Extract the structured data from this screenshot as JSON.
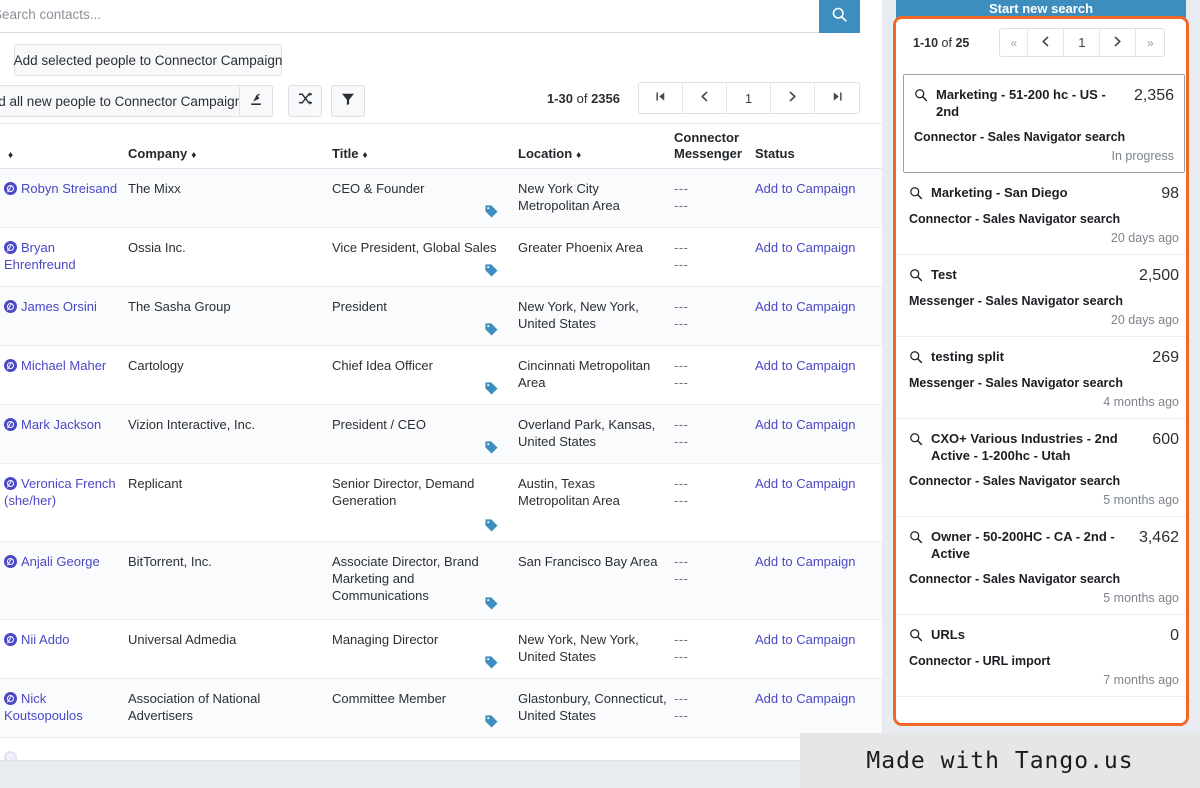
{
  "search": {
    "placeholder": "Search contacts...",
    "value": "",
    "button_icon": "search-icon"
  },
  "toolbar": {
    "add_selected_label": "Add selected people to Connector Campaign",
    "add_all_label": "Add all new people to Connector Campaign",
    "export_icon": "export-icon",
    "shuffle_icon": "shuffle-icon",
    "filter_icon": "filter-icon",
    "help_icon": "help-icon",
    "help_label": "?"
  },
  "main_pagination": {
    "range": "1-30",
    "of": "of",
    "total": "2356",
    "first": "⏮",
    "prev": "‹",
    "page": "1",
    "next": "›",
    "last": "⏭"
  },
  "table": {
    "columns": {
      "name": "",
      "company": "Company",
      "title": "Title",
      "location": "Location",
      "connector": "Connector",
      "messenger": "Messenger",
      "status": "Status"
    },
    "rows": [
      {
        "name": "Robyn Streisand",
        "company": "The Mixx",
        "title": "CEO & Founder",
        "location": "New York City Metropolitan Area",
        "connector": "---",
        "messenger": "---",
        "status": "Add to Campaign"
      },
      {
        "name": "Bryan Ehrenfreund",
        "company": "Ossia Inc.",
        "title": "Vice President, Global Sales",
        "location": "Greater Phoenix Area",
        "connector": "---",
        "messenger": "---",
        "status": "Add to Campaign"
      },
      {
        "name": "James Orsini",
        "company": "The Sasha Group",
        "title": "President",
        "location": "New York, New York, United States",
        "connector": "---",
        "messenger": "---",
        "status": "Add to Campaign"
      },
      {
        "name": "Michael Maher",
        "company": "Cartology",
        "title": "Chief Idea Officer",
        "location": "Cincinnati Metropolitan Area",
        "connector": "---",
        "messenger": "---",
        "status": "Add to Campaign"
      },
      {
        "name": "Mark Jackson",
        "company": "Vizion Interactive, Inc.",
        "title": "President / CEO",
        "location": "Overland Park, Kansas, United States",
        "connector": "---",
        "messenger": "---",
        "status": "Add to Campaign"
      },
      {
        "name": "Veronica French (she/her)",
        "company": "Replicant",
        "title": "Senior Director, Demand Generation",
        "location": "Austin, Texas Metropolitan Area",
        "connector": "---",
        "messenger": "---",
        "status": "Add to Campaign"
      },
      {
        "name": "Anjali George",
        "company": "BitTorrent, Inc.",
        "title": "Associate Director, Brand Marketing and Communications",
        "location": "San Francisco Bay Area",
        "connector": "---",
        "messenger": "---",
        "status": "Add to Campaign"
      },
      {
        "name": "Nii Addo",
        "company": "Universal Admedia",
        "title": "Managing Director",
        "location": "New York, New York, United States",
        "connector": "---",
        "messenger": "---",
        "status": "Add to Campaign"
      },
      {
        "name": "Nick Koutsopoulos",
        "company": "Association of National Advertisers",
        "title": "Committee Member",
        "location": "Glastonbury, Connecticut, United States",
        "connector": "---",
        "messenger": "---",
        "status": "Add to Campaign"
      }
    ]
  },
  "right_panel": {
    "new_search_label": "Start new search",
    "pagination": {
      "range": "1-10",
      "of": "of",
      "total": "25",
      "first": "«",
      "prev": "‹",
      "page": "1",
      "next": "›",
      "last": "»"
    },
    "searches": [
      {
        "title": "Marketing - 51-200 hc - US - 2nd",
        "count": "2,356",
        "source": "Connector - Sales Navigator search",
        "meta": "In progress",
        "selected": true
      },
      {
        "title": "Marketing - San Diego",
        "count": "98",
        "source": "Connector - Sales Navigator search",
        "meta": "20 days ago",
        "selected": false
      },
      {
        "title": "Test",
        "count": "2,500",
        "source": "Messenger - Sales Navigator search",
        "meta": "20 days ago",
        "selected": false
      },
      {
        "title": "testing split",
        "count": "269",
        "source": "Messenger - Sales Navigator search",
        "meta": "4 months ago",
        "selected": false
      },
      {
        "title": "CXO+ Various Industries - 2nd Active - 1-200hc - Utah",
        "count": "600",
        "source": "Connector - Sales Navigator search",
        "meta": "5 months ago",
        "selected": false
      },
      {
        "title": "Owner - 50-200HC - CA - 2nd - Active",
        "count": "3,462",
        "source": "Connector - Sales Navigator search",
        "meta": "5 months ago",
        "selected": false
      },
      {
        "title": "URLs",
        "count": "0",
        "source": "Connector - URL import",
        "meta": "7 months ago",
        "selected": false
      }
    ]
  },
  "watermark": {
    "text": "Made with Tango.us"
  },
  "colors": {
    "accent_blue": "#3d8dbe",
    "highlight_orange": "#f2682a",
    "link_purple": "#4a48c4",
    "tag_blue": "#3d8dbe"
  }
}
